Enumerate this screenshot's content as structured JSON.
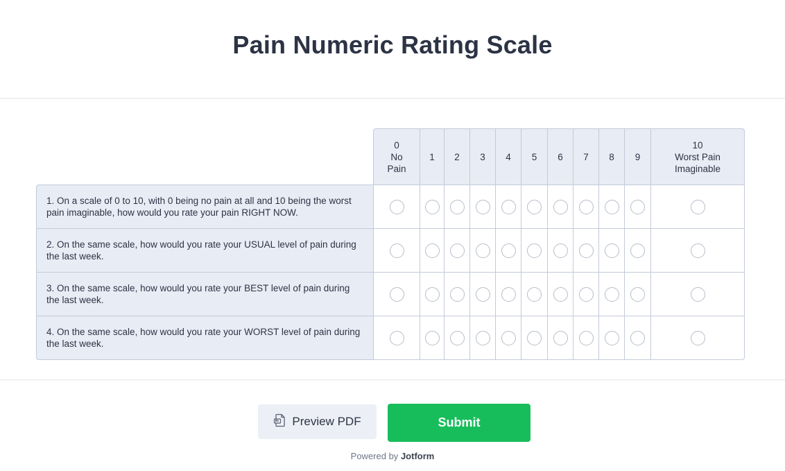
{
  "page": {
    "title": "Pain Numeric Rating Scale"
  },
  "matrix": {
    "columns": [
      [
        "0",
        "No",
        "Pain"
      ],
      [
        "1"
      ],
      [
        "2"
      ],
      [
        "3"
      ],
      [
        "4"
      ],
      [
        "5"
      ],
      [
        "6"
      ],
      [
        "7"
      ],
      [
        "8"
      ],
      [
        "9"
      ],
      [
        "10",
        "Worst Pain",
        "Imaginable"
      ]
    ],
    "rows": [
      {
        "label": "1. On a scale of 0 to 10, with 0 being no pain at all and 10 being the worst pain imaginable, how would you rate your pain RIGHT NOW."
      },
      {
        "label": "2. On the same scale, how would you rate your USUAL level of pain during the last week."
      },
      {
        "label": "3. On the same scale, how would you rate your BEST level of pain during the last week."
      },
      {
        "label": "4. On the same scale, how would you rate your WORST level of pain during the last week."
      }
    ]
  },
  "actions": {
    "preview_label": "Preview PDF",
    "preview_icon": "pdf-document-icon",
    "submit_label": "Submit"
  },
  "footer": {
    "powered_prefix": "Powered by",
    "brand": "Jotform"
  },
  "colors": {
    "submit_green": "#18bd5b",
    "header_bg": "#e8ecf4",
    "border": "#c3cad8"
  }
}
